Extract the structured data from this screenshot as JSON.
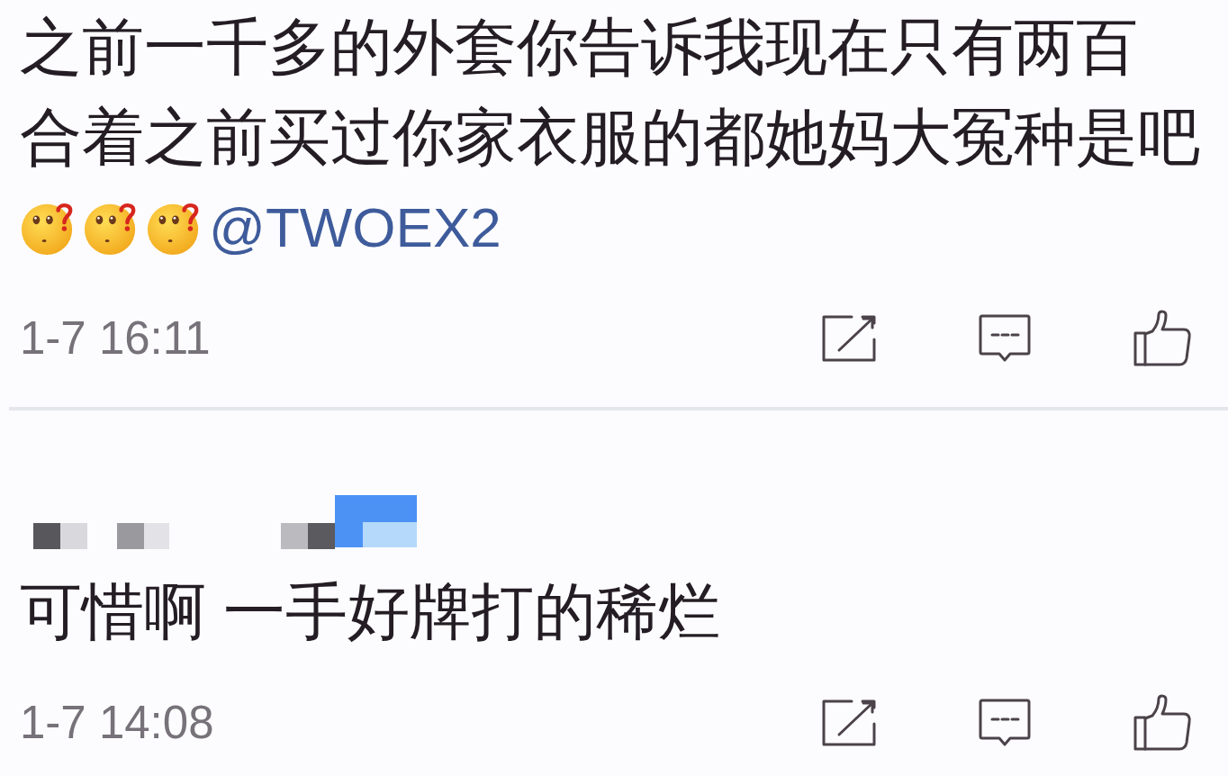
{
  "comments": [
    {
      "lines": [
        [
          {
            "kind": "text",
            "text": "之前一千多的外套你告诉我现在只有两百"
          }
        ],
        [
          {
            "kind": "text",
            "text": "合着之前买过你家衣服的都她妈大冤种是吧"
          }
        ],
        [
          {
            "kind": "emoji"
          },
          {
            "kind": "emoji"
          },
          {
            "kind": "emoji"
          },
          {
            "kind": "mention",
            "text": "@TWOEX2"
          }
        ]
      ],
      "timestamp": "1-7 16:11"
    },
    {
      "author_mosaic": true,
      "lines": [
        [
          {
            "kind": "text",
            "text": "可惜啊 一手好牌打的稀烂"
          }
        ]
      ],
      "timestamp": "1-7 14:08"
    }
  ]
}
